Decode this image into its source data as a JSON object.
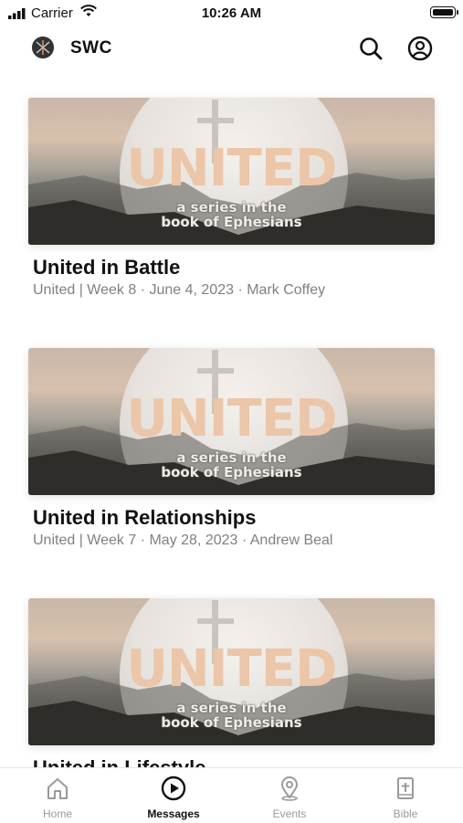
{
  "status_bar": {
    "carrier": "Carrier",
    "time": "10:26 AM"
  },
  "app_bar": {
    "title": "SWC",
    "logo_icon": "swc-logo-icon",
    "search_icon": "search-icon",
    "account_icon": "account-icon"
  },
  "messages": [
    {
      "thumbnail": {
        "headline": "UNITED",
        "line1": "a series in the",
        "line2": "book of Ephesians"
      },
      "title": "United in Battle",
      "meta": "United | Week 8 · June 4, 2023 · Mark Coffey"
    },
    {
      "thumbnail": {
        "headline": "UNITED",
        "line1": "a series in the",
        "line2": "book of Ephesians"
      },
      "title": "United in Relationships",
      "meta": "United | Week 7 · May 28, 2023 · Andrew Beal"
    },
    {
      "thumbnail": {
        "headline": "UNITED",
        "line1": "a series in the",
        "line2": "book of Ephesians"
      },
      "title": "United in Lifestyle",
      "meta": ""
    }
  ],
  "tabs": [
    {
      "label": "Home",
      "icon": "home-icon",
      "active": false
    },
    {
      "label": "Messages",
      "icon": "play-circle-icon",
      "active": true
    },
    {
      "label": "Events",
      "icon": "location-pin-icon",
      "active": false
    },
    {
      "label": "Bible",
      "icon": "bible-icon",
      "active": false
    }
  ],
  "colors": {
    "active_tab": "#111111",
    "inactive_tab": "#9a9a9a",
    "meta_text": "#808080",
    "headline_peach": "#ecc6a8"
  }
}
